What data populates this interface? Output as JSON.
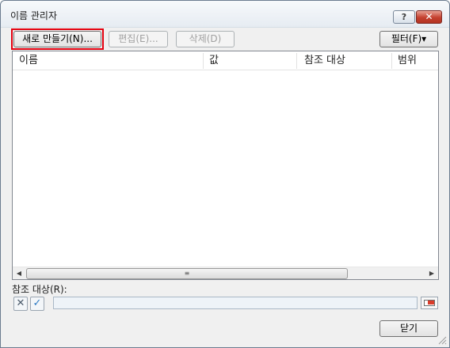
{
  "window": {
    "title": "이름 관리자"
  },
  "titlebar": {
    "help_label": "?",
    "close_label": "✕"
  },
  "toolbar": {
    "new_label": "새로 만들기(N)...",
    "edit_label": "편집(E)...",
    "delete_label": "삭제(D)",
    "filter_label": "필터(F)▾"
  },
  "list": {
    "columns": [
      "이름",
      "값",
      "참조 대상",
      "범위"
    ],
    "rows": []
  },
  "scrollbar": {
    "left_arrow": "◀",
    "right_arrow": "▶",
    "thumb_grip": "≡"
  },
  "reference": {
    "label": "참조 대상(R):",
    "cancel_glyph": "✕",
    "confirm_glyph": "✓",
    "value": ""
  },
  "footer": {
    "close_label": "닫기"
  }
}
